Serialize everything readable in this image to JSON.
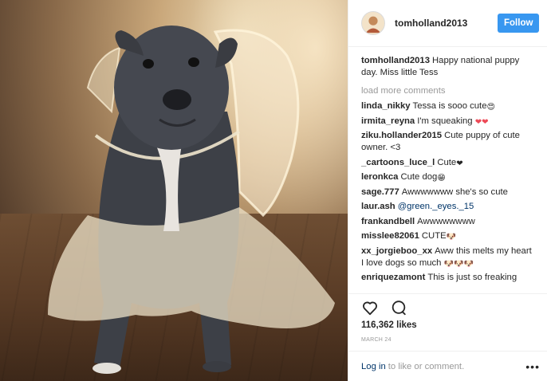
{
  "post": {
    "username": "tomholland2013",
    "follow_label": "Follow",
    "caption": "Happy national puppy day. Miss little Tess",
    "load_more": "load more comments",
    "likes": "116,362 likes",
    "date": "MARCH 24"
  },
  "comments": [
    {
      "user": "linda_nikky",
      "text": "Tessa is sooo cute",
      "emoji": "😍"
    },
    {
      "user": "irmita_reyna",
      "text": "I'm squeaking",
      "emoji": "❤❤"
    },
    {
      "user": "ziku.hollander2015",
      "text": "Cute puppy of cute owner. <3",
      "emoji": ""
    },
    {
      "user": "_cartoons_luce_l",
      "text": "Cute",
      "emoji": "❤"
    },
    {
      "user": "leronkca",
      "text": "Cute dog",
      "emoji": "😁"
    },
    {
      "user": "sage.777",
      "text": "Awwwwwww she's so cute",
      "emoji": ""
    },
    {
      "user": "laur.ash",
      "mention": "@green._eyes._15",
      "text": "",
      "emoji": ""
    },
    {
      "user": "frankandbell",
      "text": "Awwwwwwww",
      "emoji": ""
    },
    {
      "user": "misslee82061",
      "text": "CUTE",
      "emoji": "🐶"
    },
    {
      "user": "xx_jorgieboo_xx",
      "text": "Aww this melts my heart I love dogs so much",
      "emoji": "🐶🐶🐶"
    },
    {
      "user": "enriquezamont",
      "text": "This is just so freaking",
      "emoji": ""
    }
  ],
  "footer": {
    "login": "Log in",
    "rest": "to like or comment.",
    "more": "•••"
  },
  "colors": {
    "accent": "#3897f0",
    "link": "#003569",
    "heart": "#ed4956"
  }
}
